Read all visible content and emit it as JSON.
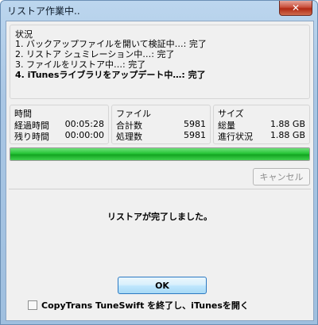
{
  "window": {
    "title": "リストア作業中..",
    "close_glyph": "✕"
  },
  "status": {
    "title": "状況",
    "lines": [
      "1. バックアップファイルを開いて検証中…: 完了",
      "2. リストア シュミレーション中…: 完了",
      "3. ファイルをリストア中…: 完了",
      "4. iTunesライブラリをアップデート中…: 完了"
    ]
  },
  "time": {
    "title": "時間",
    "elapsed_label": "経過時間",
    "elapsed_value": "00:05:28",
    "remaining_label": "残り時間",
    "remaining_value": "00:00:00"
  },
  "files": {
    "title": "ファイル",
    "total_label": "合計数",
    "total_value": "5981",
    "processed_label": "処理数",
    "processed_value": "5981"
  },
  "size": {
    "title": "サイズ",
    "total_label": "総量",
    "total_value": "1.88 GB",
    "progress_label": "進行状況",
    "progress_value": "1.88 GB"
  },
  "progress": {
    "fraction": 1.0
  },
  "buttons": {
    "cancel": "キャンセル",
    "ok": "OK"
  },
  "message": "リストアが完了しました。",
  "checkbox": {
    "label": "CopyTrans TuneSwift を終了し、iTunesを開く",
    "checked": false
  },
  "colors": {
    "progress": "#1fb52f",
    "accent": "#2b79c2"
  }
}
